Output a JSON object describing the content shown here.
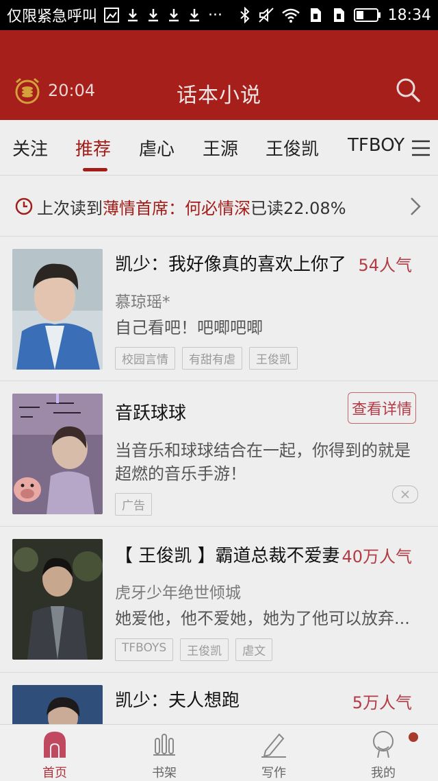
{
  "status_bar": {
    "carrier": "仅限紧急呼叫",
    "time": "18:34"
  },
  "header": {
    "time": "20:04",
    "title": "话本小说"
  },
  "tabs": [
    {
      "label": "关注"
    },
    {
      "label": "推荐",
      "active": true
    },
    {
      "label": "虐心"
    },
    {
      "label": "王源"
    },
    {
      "label": "王俊凯"
    },
    {
      "label": "TFBOY"
    }
  ],
  "last_read": {
    "prefix": "上次读到",
    "book": "薄情首席：何必情深",
    "suffix": "已读22.08%"
  },
  "stories": [
    {
      "title": "凯少：我好像真的喜欢上你了",
      "popularity": "54人气",
      "author": "慕琼瑶*",
      "desc": "自己看吧！吧唧吧唧",
      "tags": [
        "校园言情",
        "有甜有虐",
        "王俊凯"
      ]
    },
    {
      "title": "音跃球球",
      "button": "查看详情",
      "desc": "当音乐和球球结合在一起，你得到的就是超燃的音乐手游！",
      "tag": "广告"
    },
    {
      "title": "【 王俊凯 】霸道总裁不爱妻",
      "popularity": "40万人气",
      "author": "虎牙少年绝世倾城",
      "desc": "她爱他，他不爱她，她为了他可以放弃...",
      "tags": [
        "TFBOYS",
        "王俊凯",
        "虐文"
      ]
    },
    {
      "title": "凯少：夫人想跑",
      "popularity": "5万人气"
    }
  ],
  "bottom_nav": [
    {
      "label": "首页",
      "icon": "home-icon",
      "active": true
    },
    {
      "label": "书架",
      "icon": "bookshelf-icon"
    },
    {
      "label": "写作",
      "icon": "pen-icon"
    },
    {
      "label": "我的",
      "icon": "profile-icon"
    }
  ],
  "colors": {
    "header": "#a61f1a",
    "accent": "#a31d18",
    "popularity": "#b33b45"
  }
}
